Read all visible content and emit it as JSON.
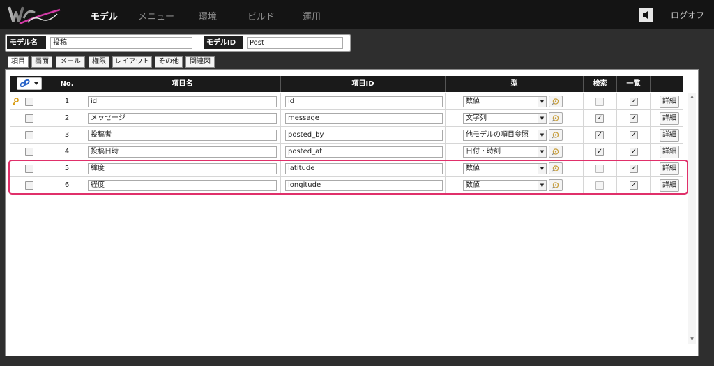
{
  "nav": {
    "items": [
      "モデル",
      "メニュー",
      "環境",
      "ビルド",
      "運用"
    ],
    "logout": "ログオフ"
  },
  "model": {
    "name_label": "モデル名",
    "name_value": "投稿",
    "id_label": "モデルID",
    "id_value": "Post"
  },
  "tabs": [
    "項目",
    "画面",
    "メール",
    "権限",
    "レイアウト",
    "その他",
    "関連図"
  ],
  "table": {
    "headers": {
      "no": "No.",
      "item_name": "項目名",
      "item_id": "項目ID",
      "type": "型",
      "search": "検索",
      "list": "一覧"
    },
    "detail_label": "詳細",
    "rows": [
      {
        "no": "1",
        "name": "id",
        "id": "id",
        "type": "数値",
        "search": false,
        "search_enabled": false,
        "list": true,
        "key": true
      },
      {
        "no": "2",
        "name": "メッセージ",
        "id": "message",
        "type": "文字列",
        "search": true,
        "search_enabled": true,
        "list": true,
        "key": false
      },
      {
        "no": "3",
        "name": "投稿者",
        "id": "posted_by",
        "type": "他モデルの項目参照",
        "search": true,
        "search_enabled": true,
        "list": true,
        "key": false
      },
      {
        "no": "4",
        "name": "投稿日時",
        "id": "posted_at",
        "type": "日付・時刻",
        "search": true,
        "search_enabled": true,
        "list": true,
        "key": false
      },
      {
        "no": "5",
        "name": "緯度",
        "id": "latitude",
        "type": "数値",
        "search": false,
        "search_enabled": false,
        "list": true,
        "key": false
      },
      {
        "no": "6",
        "name": "経度",
        "id": "longitude",
        "type": "数値",
        "search": false,
        "search_enabled": false,
        "list": true,
        "key": false
      }
    ]
  },
  "icons": {
    "logo": "wagby-designer-logo",
    "sound": "speaker-icon",
    "key": "key-icon",
    "tool": "link-tool-icon",
    "type_detail": "edit-type-icon"
  },
  "colors": {
    "accent": "#e0306a",
    "topbar": "#141414",
    "background": "#2e2e2e"
  }
}
